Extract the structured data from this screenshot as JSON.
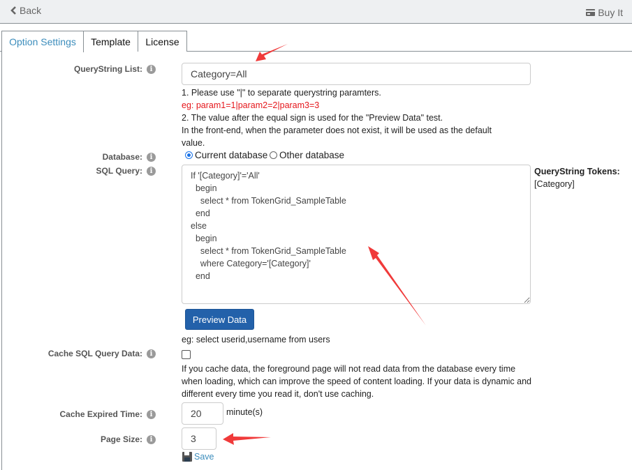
{
  "topbar": {
    "back_label": "Back",
    "buy_label": "Buy It"
  },
  "tabs": [
    {
      "label": "Option Settings",
      "active": true
    },
    {
      "label": "Template",
      "active": false
    },
    {
      "label": "License",
      "active": false
    }
  ],
  "querystring": {
    "label": "QueryString List:",
    "value": "Category=All",
    "help_line1": "1. Please use \"|\" to separate querystring paramters.",
    "help_example": "eg: param1=1|param2=2|param3=3",
    "help_line2": "2. The value after the equal sign is used for the \"Preview Data\" test.",
    "help_line3": "In the front-end, when the parameter does not exist, it will be used as the default value."
  },
  "database": {
    "label": "Database:",
    "options": [
      {
        "label": "Current database",
        "selected": true
      },
      {
        "label": "Other database",
        "selected": false
      }
    ]
  },
  "sql": {
    "label": "SQL Query:",
    "value": "If '[Category]'='All'\n  begin\n    select * from TokenGrid_SampleTable\n  end\nelse\n  begin\n    select * from TokenGrid_SampleTable\n    where Category='[Category]'\n  end",
    "tokens_title": "QueryString Tokens:",
    "tokens_value": "[Category]",
    "preview_button": "Preview Data",
    "example": "eg: select userid,username from users"
  },
  "cache": {
    "label": "Cache SQL Query Data:",
    "checked": false,
    "help": "If you cache data, the foreground page will not read data from the database every time when loading, which can improve the speed of content loading. If your data is dynamic and different every time you read it, don't use caching."
  },
  "cache_expired": {
    "label": "Cache Expired Time:",
    "value": "20",
    "unit": "minute(s)"
  },
  "page_size": {
    "label": "Page Size:",
    "value": "3"
  },
  "save_label": "Save",
  "info_glyph": "i",
  "annotation_color": "#f03a3a"
}
